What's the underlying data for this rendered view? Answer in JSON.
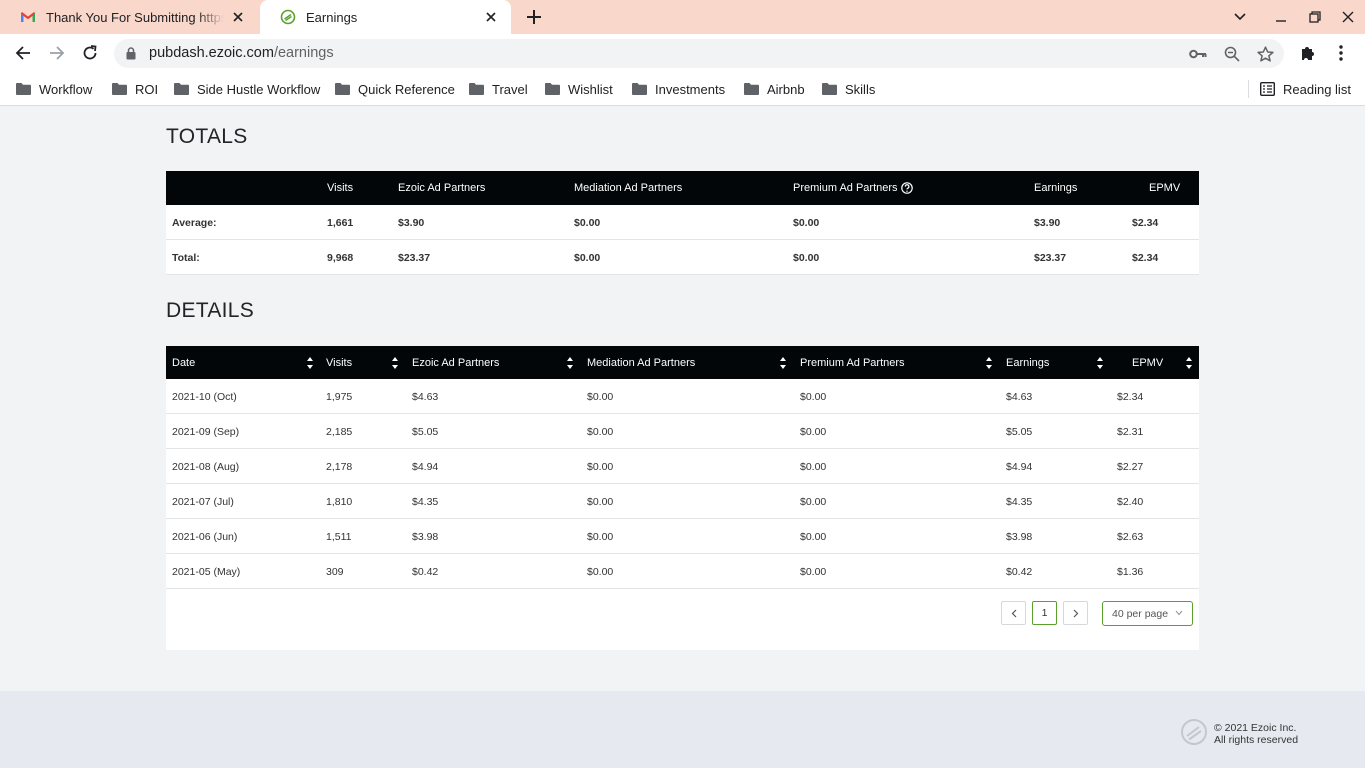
{
  "browser": {
    "tabs": [
      {
        "title": "Thank You For Submitting https://",
        "favicon": "gmail-icon",
        "active": false
      },
      {
        "title": "Earnings",
        "favicon": "ezoic-icon",
        "active": true
      }
    ],
    "url_domain": "pubdash.ezoic.com",
    "url_path": "/earnings",
    "bookmarks": [
      "Workflow",
      "ROI",
      "Side Hustle Workflow",
      "Quick Reference",
      "Travel",
      "Wishlist",
      "Investments",
      "Airbnb",
      "Skills"
    ],
    "reading_list": "Reading list",
    "tab_color": "#f9d8cb"
  },
  "totals": {
    "title": "TOTALS",
    "headers": [
      "",
      "Visits",
      "Ezoic Ad Partners",
      "Mediation Ad Partners",
      "Premium Ad Partners",
      "Earnings",
      "EPMV"
    ],
    "rows": [
      {
        "label": "Average:",
        "visits": "1,661",
        "ezoic": "$3.90",
        "mediation": "$0.00",
        "premium": "$0.00",
        "earnings": "$3.90",
        "epmv": "$2.34"
      },
      {
        "label": "Total:",
        "visits": "9,968",
        "ezoic": "$23.37",
        "mediation": "$0.00",
        "premium": "$0.00",
        "earnings": "$23.37",
        "epmv": "$2.34"
      }
    ]
  },
  "details": {
    "title": "DETAILS",
    "headers": [
      "Date",
      "Visits",
      "Ezoic Ad Partners",
      "Mediation Ad Partners",
      "Premium Ad Partners",
      "Earnings",
      "EPMV"
    ],
    "rows": [
      {
        "date": "2021-10 (Oct)",
        "visits": "1,975",
        "ezoic": "$4.63",
        "mediation": "$0.00",
        "premium": "$0.00",
        "earnings": "$4.63",
        "epmv": "$2.34"
      },
      {
        "date": "2021-09 (Sep)",
        "visits": "2,185",
        "ezoic": "$5.05",
        "mediation": "$0.00",
        "premium": "$0.00",
        "earnings": "$5.05",
        "epmv": "$2.31"
      },
      {
        "date": "2021-08 (Aug)",
        "visits": "2,178",
        "ezoic": "$4.94",
        "mediation": "$0.00",
        "premium": "$0.00",
        "earnings": "$4.94",
        "epmv": "$2.27"
      },
      {
        "date": "2021-07 (Jul)",
        "visits": "1,810",
        "ezoic": "$4.35",
        "mediation": "$0.00",
        "premium": "$0.00",
        "earnings": "$4.35",
        "epmv": "$2.40"
      },
      {
        "date": "2021-06 (Jun)",
        "visits": "1,511",
        "ezoic": "$3.98",
        "mediation": "$0.00",
        "premium": "$0.00",
        "earnings": "$3.98",
        "epmv": "$2.63"
      },
      {
        "date": "2021-05 (May)",
        "visits": "309",
        "ezoic": "$0.42",
        "mediation": "$0.00",
        "premium": "$0.00",
        "earnings": "$0.42",
        "epmv": "$1.36"
      }
    ],
    "pagination": {
      "current_page": "1",
      "per_page": "40 per page"
    }
  },
  "footer": {
    "copyright": "© 2021 Ezoic Inc.",
    "rights": "All rights reserved"
  },
  "colors": {
    "table_header": "#020608",
    "accent_green": "#5aa02c",
    "page_bg": "#f1f3f5",
    "footer_bg": "#e6e9ef"
  }
}
